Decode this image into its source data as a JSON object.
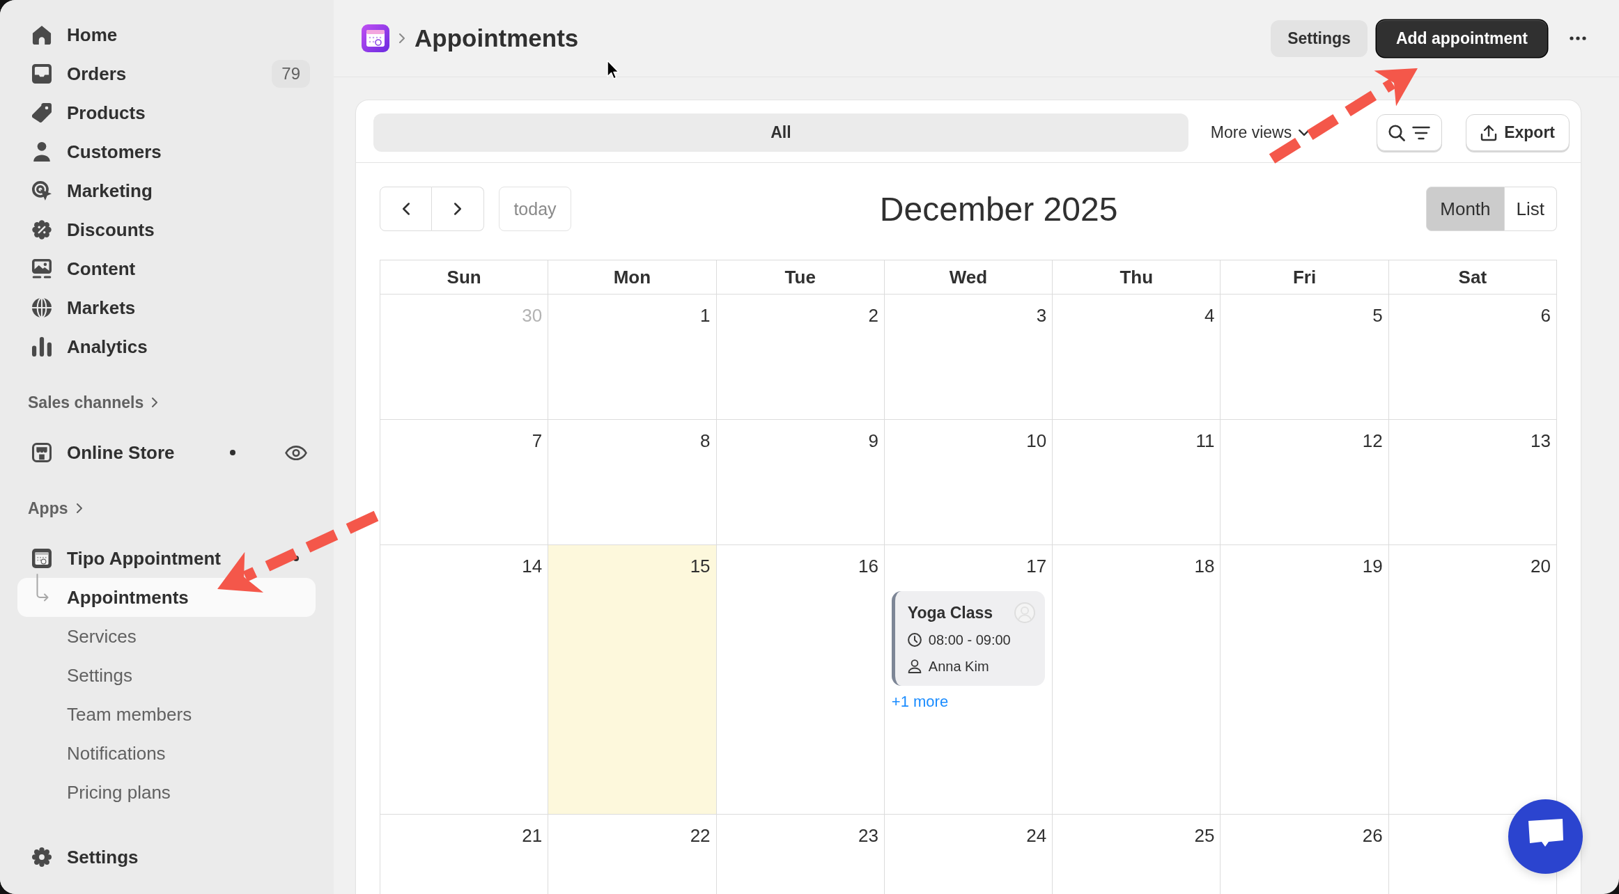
{
  "sidebar": {
    "nav": [
      {
        "label": "Home",
        "selected": false
      },
      {
        "label": "Orders",
        "selected": false,
        "badge": "79"
      },
      {
        "label": "Products",
        "selected": false
      },
      {
        "label": "Customers",
        "selected": false
      },
      {
        "label": "Marketing",
        "selected": false
      },
      {
        "label": "Discounts",
        "selected": false
      },
      {
        "label": "Content",
        "selected": false
      },
      {
        "label": "Markets",
        "selected": false
      },
      {
        "label": "Analytics",
        "selected": false
      }
    ],
    "sales_channels": {
      "heading": "Sales channels",
      "items": [
        {
          "label": "Online Store",
          "selected": false
        }
      ]
    },
    "apps": {
      "heading": "Apps",
      "items": [
        {
          "label": "Tipo Appointment",
          "selected": false,
          "children": [
            {
              "label": "Appointments",
              "selected": true
            },
            {
              "label": "Services",
              "selected": false
            },
            {
              "label": "Settings",
              "selected": false
            },
            {
              "label": "Team members",
              "selected": false
            },
            {
              "label": "Notifications",
              "selected": false
            },
            {
              "label": "Pricing plans",
              "selected": false
            }
          ]
        }
      ]
    },
    "footer": {
      "label": "Settings",
      "selected": false
    }
  },
  "header": {
    "title": "Appointments",
    "actions": [
      {
        "label": "Settings",
        "kind": "secondary"
      },
      {
        "label": "Add appointment",
        "kind": "primary"
      }
    ]
  },
  "views": {
    "tabs": [
      {
        "label": "All",
        "selected": true
      }
    ],
    "more_views": "More views",
    "export": "Export"
  },
  "calendar": {
    "today_button": {
      "label": "today",
      "disabled": true
    },
    "title": "December 2025",
    "view_toggle": [
      {
        "label": "Month",
        "selected": true
      },
      {
        "label": "List",
        "selected": false
      }
    ],
    "weekdays": [
      "Sun",
      "Mon",
      "Tue",
      "Wed",
      "Thu",
      "Fri",
      "Sat"
    ],
    "weeks": [
      {
        "days": [
          {
            "label": "30",
            "outside_month": true,
            "today": false
          },
          {
            "label": "1",
            "outside_month": false,
            "today": false
          },
          {
            "label": "2",
            "outside_month": false,
            "today": false
          },
          {
            "label": "3",
            "outside_month": false,
            "today": false
          },
          {
            "label": "4",
            "outside_month": false,
            "today": false
          },
          {
            "label": "5",
            "outside_month": false,
            "today": false
          },
          {
            "label": "6",
            "outside_month": false,
            "today": false
          }
        ]
      },
      {
        "days": [
          {
            "label": "7",
            "outside_month": false,
            "today": false
          },
          {
            "label": "8",
            "outside_month": false,
            "today": false
          },
          {
            "label": "9",
            "outside_month": false,
            "today": false
          },
          {
            "label": "10",
            "outside_month": false,
            "today": false
          },
          {
            "label": "11",
            "outside_month": false,
            "today": false
          },
          {
            "label": "12",
            "outside_month": false,
            "today": false
          },
          {
            "label": "13",
            "outside_month": false,
            "today": false
          }
        ]
      },
      {
        "days": [
          {
            "label": "14",
            "outside_month": false,
            "today": false
          },
          {
            "label": "15",
            "outside_month": false,
            "today": true
          },
          {
            "label": "16",
            "outside_month": false,
            "today": false
          },
          {
            "label": "17",
            "outside_month": false,
            "today": false,
            "events": [
              {
                "title": "Yoga Class",
                "time": "08:00 - 09:00",
                "person": "Anna Kim"
              }
            ],
            "more": "+1 more"
          },
          {
            "label": "18",
            "outside_month": false,
            "today": false
          },
          {
            "label": "19",
            "outside_month": false,
            "today": false
          },
          {
            "label": "20",
            "outside_month": false,
            "today": false
          }
        ]
      },
      {
        "days": [
          {
            "label": "21",
            "outside_month": false,
            "today": false
          },
          {
            "label": "22",
            "outside_month": false,
            "today": false
          },
          {
            "label": "23",
            "outside_month": false,
            "today": false
          },
          {
            "label": "24",
            "outside_month": false,
            "today": false
          },
          {
            "label": "25",
            "outside_month": false,
            "today": false
          },
          {
            "label": "26",
            "outside_month": false,
            "today": false
          }
        ]
      }
    ]
  }
}
